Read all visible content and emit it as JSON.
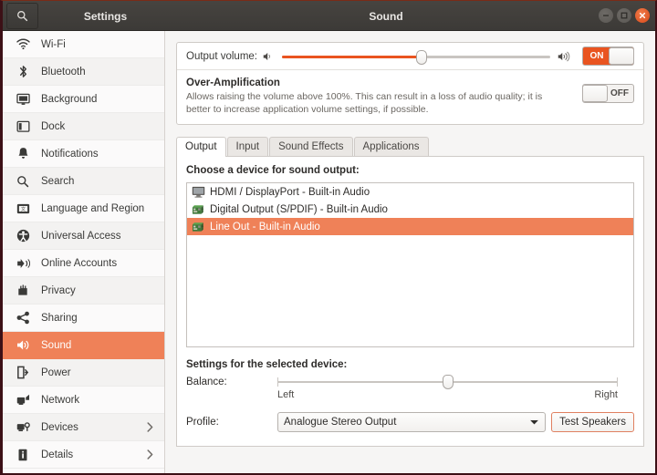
{
  "titlebar": {
    "search_icon": "search-icon",
    "settings_title": "Settings",
    "window_title": "Sound",
    "minimize": "minimize-icon",
    "maximize": "maximize-icon",
    "close": "close-icon"
  },
  "sidebar": {
    "items": [
      {
        "label": "Wi-Fi",
        "icon": "wifi-icon",
        "selected": false,
        "chevron": false
      },
      {
        "label": "Bluetooth",
        "icon": "bluetooth-icon",
        "selected": false,
        "chevron": false
      },
      {
        "label": "Background",
        "icon": "background-icon",
        "selected": false,
        "chevron": false
      },
      {
        "label": "Dock",
        "icon": "dock-icon",
        "selected": false,
        "chevron": false
      },
      {
        "label": "Notifications",
        "icon": "bell-icon",
        "selected": false,
        "chevron": false
      },
      {
        "label": "Search",
        "icon": "search-icon",
        "selected": false,
        "chevron": false
      },
      {
        "label": "Language and Region",
        "icon": "language-icon",
        "selected": false,
        "chevron": false
      },
      {
        "label": "Universal Access",
        "icon": "accessibility-icon",
        "selected": false,
        "chevron": false
      },
      {
        "label": "Online Accounts",
        "icon": "online-accounts-icon",
        "selected": false,
        "chevron": false
      },
      {
        "label": "Privacy",
        "icon": "privacy-hand-icon",
        "selected": false,
        "chevron": false
      },
      {
        "label": "Sharing",
        "icon": "share-icon",
        "selected": false,
        "chevron": false
      },
      {
        "label": "Sound",
        "icon": "speaker-icon",
        "selected": true,
        "chevron": false
      },
      {
        "label": "Power",
        "icon": "power-battery-icon",
        "selected": false,
        "chevron": false
      },
      {
        "label": "Network",
        "icon": "network-icon",
        "selected": false,
        "chevron": false
      },
      {
        "label": "Devices",
        "icon": "devices-icon",
        "selected": false,
        "chevron": true
      },
      {
        "label": "Details",
        "icon": "details-info-icon",
        "selected": false,
        "chevron": true
      }
    ]
  },
  "main": {
    "output_volume": {
      "label": "Output volume:",
      "low_icon": "volume-low-icon",
      "high_icon": "volume-high-icon",
      "value_percent": 52,
      "toggle_label": "ON",
      "toggle_state": "on"
    },
    "over_amplification": {
      "title": "Over-Amplification",
      "description": "Allows raising the volume above 100%. This can result in a loss of audio quality; it is better to increase application volume settings, if possible.",
      "toggle_label": "OFF",
      "toggle_state": "off"
    },
    "tabs": [
      {
        "label": "Output",
        "active": true
      },
      {
        "label": "Input",
        "active": false
      },
      {
        "label": "Sound Effects",
        "active": false
      },
      {
        "label": "Applications",
        "active": false
      }
    ],
    "output_tab": {
      "choose_label": "Choose a device for sound output:",
      "devices": [
        {
          "label": "HDMI / DisplayPort - Built-in Audio",
          "icon": "monitor-icon",
          "selected": false
        },
        {
          "label": "Digital Output (S/PDIF) - Built-in Audio",
          "icon": "soundcard-icon",
          "selected": false
        },
        {
          "label": "Line Out - Built-in Audio",
          "icon": "soundcard-icon",
          "selected": true
        }
      ],
      "settings_label": "Settings for the selected device:",
      "balance": {
        "label": "Balance:",
        "left_label": "Left",
        "right_label": "Right",
        "value_percent": 50
      },
      "profile": {
        "label": "Profile:",
        "value": "Analogue Stereo Output",
        "dropdown_icon": "chevron-down-icon"
      },
      "test_speakers_label": "Test Speakers"
    }
  },
  "colors": {
    "accent": "#e95420",
    "selection": "#ef8158",
    "titlebar": "#3c3a37",
    "sidebar_bg": "#fbfafa"
  }
}
